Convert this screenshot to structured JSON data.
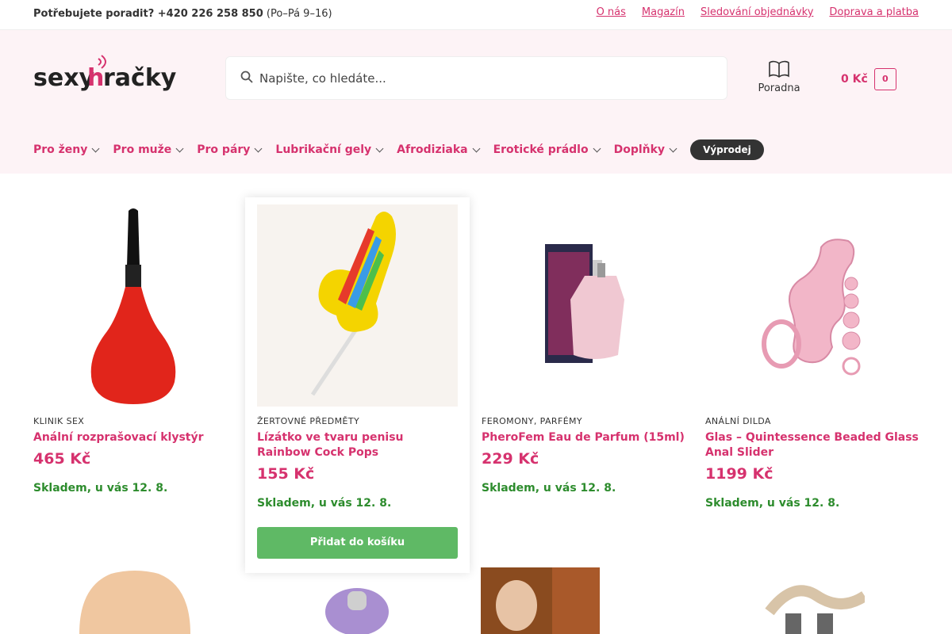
{
  "topbar": {
    "help_prefix": "Potřebujete poradit? +420 226 258 850",
    "help_hours": "(Po–Pá 9–16)",
    "links": [
      "O nás",
      "Magazín",
      "Sledování objednávky",
      "Doprava a platba"
    ]
  },
  "header": {
    "logo_text": "sexyhračky",
    "search_placeholder": "Napište, co hledáte...",
    "poradna_label": "Poradna",
    "cart_amount": "0 Kč",
    "cart_count": "0"
  },
  "nav": {
    "items": [
      "Pro ženy",
      "Pro muže",
      "Pro páry",
      "Lubrikační gely",
      "Afrodiziaka",
      "Erotické prádlo",
      "Doplňky"
    ],
    "sale": "Výprodej"
  },
  "products": [
    {
      "category": "KLINIK SEX",
      "name": "Anální rozprašovací klystýr",
      "price": "465 Kč",
      "stock": "Skladem, u vás 12. 8."
    },
    {
      "category": "ŽERTOVNÉ PŘEDMĚTY",
      "name": "Lízátko ve tvaru penisu Rainbow Cock Pops",
      "price": "155 Kč",
      "stock": "Skladem, u vás 12. 8.",
      "button": "Přidat do košíku"
    },
    {
      "category": "FEROMONY, PARFÉMY",
      "name": "PheroFem Eau de Parfum (15ml)",
      "price": "229 Kč",
      "stock": "Skladem, u vás 12. 8."
    },
    {
      "category": "ANÁLNÍ DILDA",
      "name": "Glas – Quintessence Beaded Glass Anal Slider",
      "price": "1199 Kč",
      "stock": "Skladem, u vás 12. 8."
    }
  ],
  "colors": {
    "accent": "#d6326e",
    "stock": "#2d8c2d",
    "button": "#5fb965"
  }
}
